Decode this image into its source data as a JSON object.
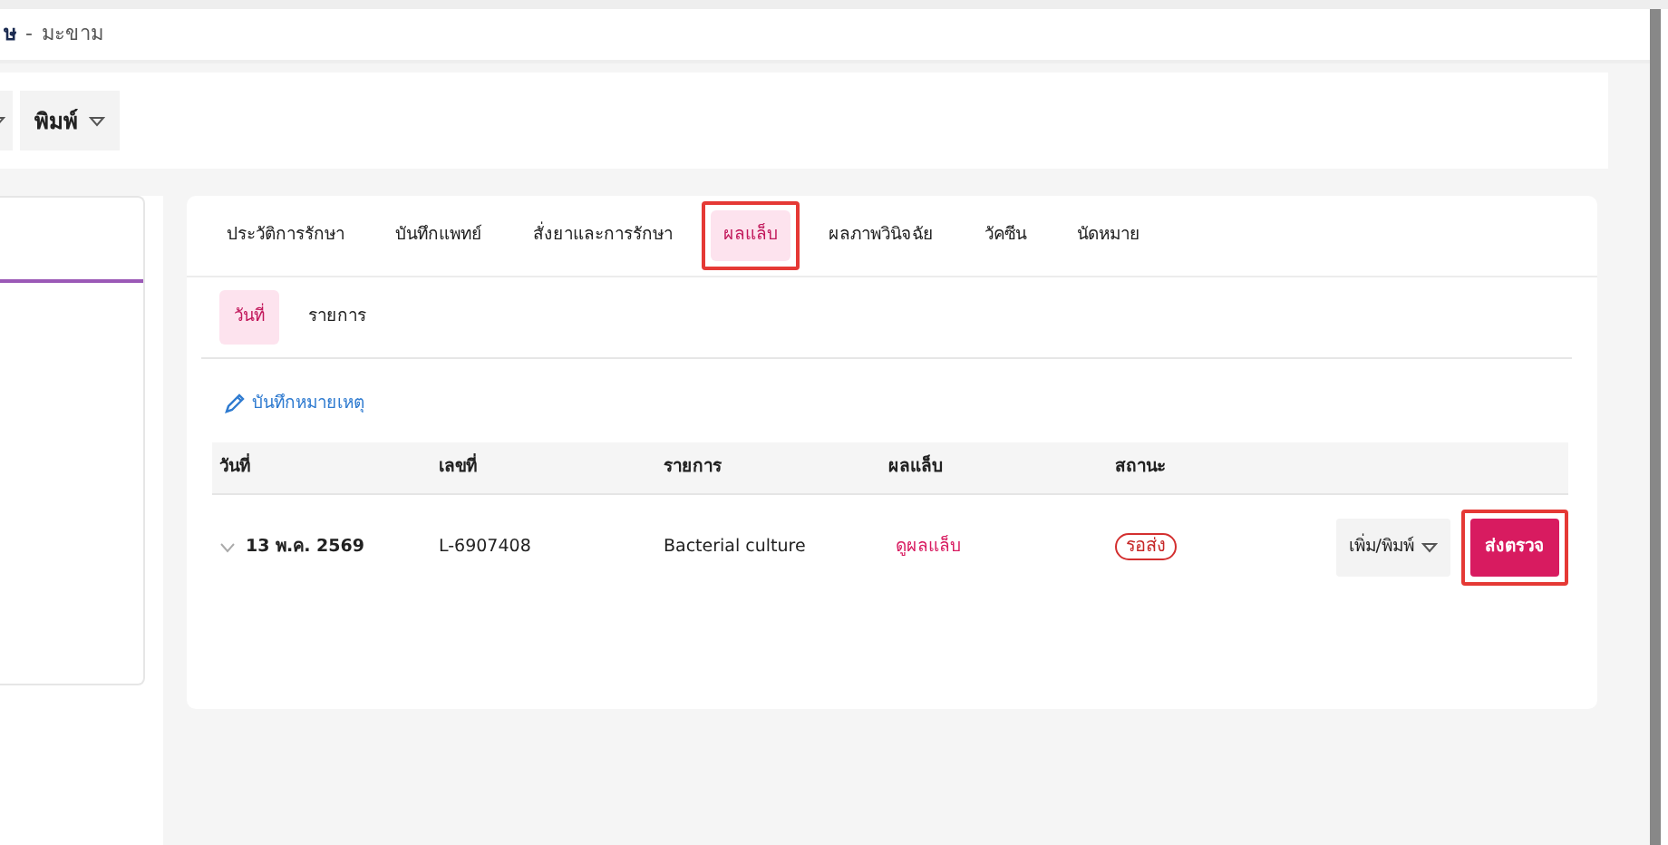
{
  "header": {
    "name": "ษ",
    "separator": "-",
    "place": "มะขาม"
  },
  "toolbar": {
    "buttons": [
      {
        "kind": "cut"
      },
      {
        "label": "พิมพ์",
        "kind": "dropdown"
      }
    ]
  },
  "tabs": [
    {
      "label": "ประวัติการรักษา",
      "selected": false,
      "annotated": false
    },
    {
      "label": "บันทึกแพทย์",
      "selected": false,
      "annotated": false
    },
    {
      "label": "สั่งยาและการรักษา",
      "selected": false,
      "annotated": false
    },
    {
      "label": "ผลแล็บ",
      "selected": true,
      "annotated": true
    },
    {
      "label": "ผลภาพวินิจฉัย",
      "selected": false,
      "annotated": false
    },
    {
      "label": "วัคซีน",
      "selected": false,
      "annotated": false
    },
    {
      "label": "นัดหมาย",
      "selected": false,
      "annotated": false
    }
  ],
  "subtabs": [
    {
      "label": "วันที่",
      "selected": true
    },
    {
      "label": "รายการ",
      "selected": false
    }
  ],
  "note_link": "บันทึกหมายเหตุ",
  "table": {
    "columns": [
      "วันที่",
      "เลขที่",
      "รายการ",
      "ผลแล็บ",
      "สถานะ"
    ],
    "rows": [
      {
        "date": "13 พ.ค. 2569",
        "number": "L-6907408",
        "item": "Bacterial culture",
        "result_link": "ดูผลแล็บ",
        "status": "รอส่ง",
        "expanded": false,
        "actions": [
          {
            "label": "เพิ่ม/พิมพ์",
            "kind": "dropdown",
            "annotated": false
          },
          {
            "label": "ส่งตรวจ",
            "kind": "primary",
            "annotated": true
          }
        ]
      }
    ]
  }
}
